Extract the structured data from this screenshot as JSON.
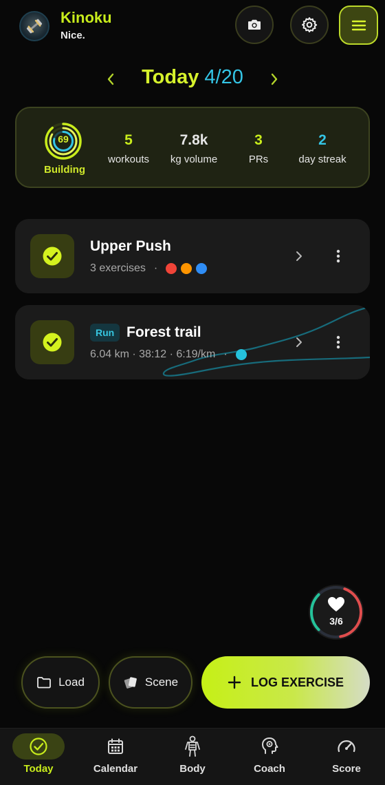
{
  "header": {
    "app_name": "Kinoku",
    "subtitle": "Nice.",
    "icons": {
      "avatar": "dumbbell-avatar",
      "camera": "camera-icon",
      "settings": "gear-icon",
      "menu": "hamburger-icon"
    }
  },
  "date_nav": {
    "today_label": "Today",
    "date": "4/20"
  },
  "summary": {
    "score": "69",
    "score_value": 69,
    "score_label": "Building",
    "stats": [
      {
        "value": "5",
        "label": "workouts",
        "color": "#c8ec1c"
      },
      {
        "value": "7.8k",
        "label": "kg volume",
        "color": "#e6e6e6"
      },
      {
        "value": "3",
        "label": "PRs",
        "color": "#c8ec1c"
      },
      {
        "value": "2",
        "label": "day streak",
        "color": "#34c5e6"
      }
    ]
  },
  "workouts": [
    {
      "title": "Upper Push",
      "meta": "3 exercises",
      "separator": "·",
      "dot_colors": [
        "#f04438",
        "#ff9500",
        "#2f8df5"
      ]
    },
    {
      "tag": "Run",
      "title": "Forest trail",
      "meta": "6.04 km · 38:12 · 6:19/km",
      "separator": "·",
      "dot_color": "#25c2dc"
    }
  ],
  "heart_widget": {
    "value": "3/6",
    "fraction": 0.5,
    "colors": [
      "#e04d4d",
      "#25c29a"
    ]
  },
  "actions": {
    "load": "Load",
    "scene": "Scene",
    "log": "LOG EXERCISE"
  },
  "tabs": [
    {
      "label": "Today",
      "icon": "check-circle-icon",
      "active": true
    },
    {
      "label": "Calendar",
      "icon": "calendar-icon",
      "active": false
    },
    {
      "label": "Body",
      "icon": "body-icon",
      "active": false
    },
    {
      "label": "Coach",
      "icon": "head-gear-icon",
      "active": false
    },
    {
      "label": "Score",
      "icon": "gauge-icon",
      "active": false
    }
  ],
  "colors": {
    "accent": "#c8ec1c",
    "cyan": "#34c5e6",
    "background": "#080808",
    "card": "#1b1b1b"
  }
}
